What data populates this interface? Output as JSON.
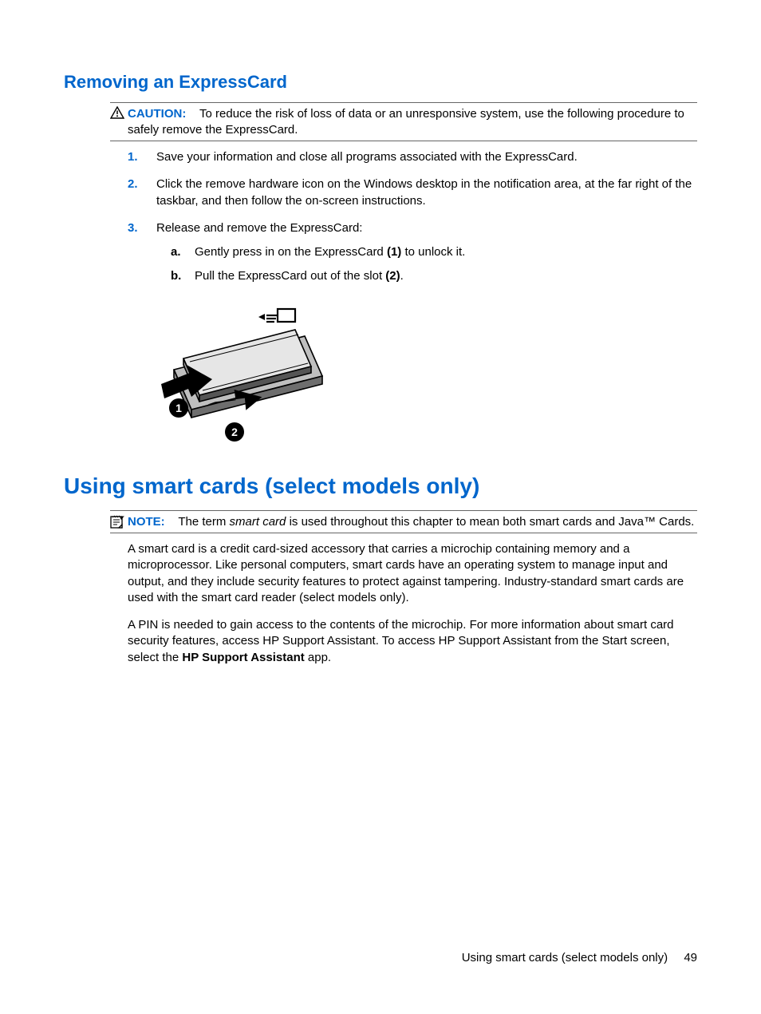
{
  "section1": {
    "title": "Removing an ExpressCard",
    "caution_label": "CAUTION:",
    "caution_text": "To reduce the risk of loss of data or an unresponsive system, use the following procedure to safely remove the ExpressCard.",
    "steps": [
      {
        "num": "1.",
        "text": "Save your information and close all programs associated with the ExpressCard."
      },
      {
        "num": "2.",
        "text": "Click the remove hardware icon on the Windows desktop in the notification area, at the far right of the taskbar, and then follow the on-screen instructions."
      },
      {
        "num": "3.",
        "text": "Release and remove the ExpressCard:"
      }
    ],
    "substeps": [
      {
        "letter": "a.",
        "pre": "Gently press in on the ExpressCard ",
        "bold": "(1)",
        "post": " to unlock it."
      },
      {
        "letter": "b.",
        "pre": "Pull the ExpressCard out of the slot ",
        "bold": "(2)",
        "post": "."
      }
    ]
  },
  "section2": {
    "title": "Using smart cards (select models only)",
    "note_label": "NOTE:",
    "note_pre": "The term ",
    "note_italic": "smart card",
    "note_post": " is used throughout this chapter to mean both smart cards and Java™ Cards.",
    "para1": "A smart card is a credit card-sized accessory that carries a microchip containing memory and a microprocessor. Like personal computers, smart cards have an operating system to manage input and output, and they include security features to protect against tampering. Industry-standard smart cards are used with the smart card reader (select models only).",
    "para2_pre": "A PIN is needed to gain access to the contents of the microchip. For more information about smart card security features, access HP Support Assistant. To access HP Support Assistant from the Start screen, select the ",
    "para2_bold": "HP Support Assistant",
    "para2_post": " app."
  },
  "footer": {
    "text": "Using smart cards (select models only)",
    "page": "49"
  }
}
